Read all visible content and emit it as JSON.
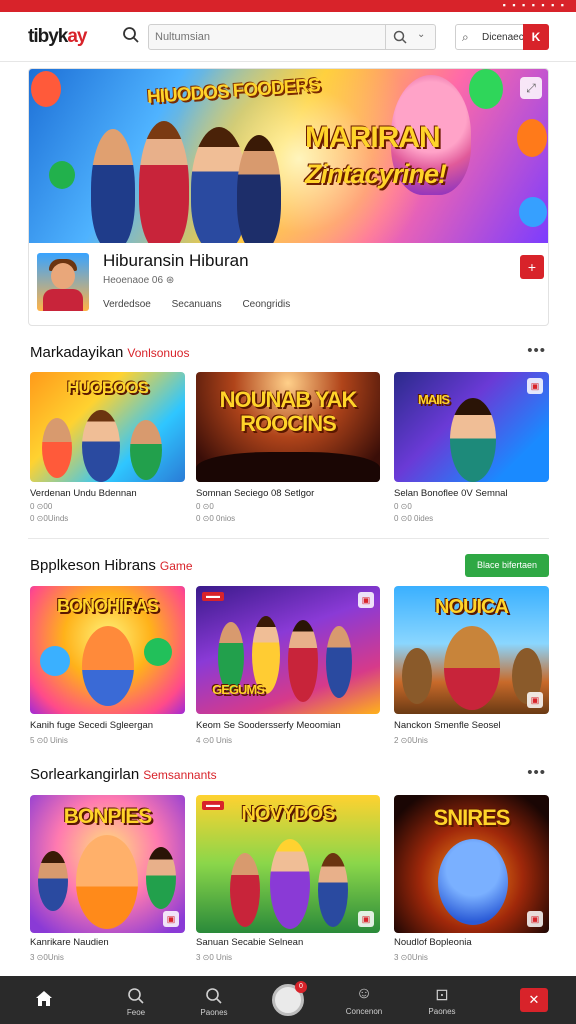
{
  "app": {
    "name_main": "tibyk",
    "name_accent": "ay"
  },
  "status_bar": {
    "icons_text": "▪ ▪ ▪ ▪ ▪ ▪ ▪"
  },
  "search": {
    "placeholder": "Nultumsian",
    "value": ""
  },
  "discover": {
    "label": "Dicenaec"
  },
  "hero": {
    "banner_line1": "HIUODOS FOODERS",
    "banner_line2": "MARIRAN",
    "banner_line3": "Zintacyrine!",
    "title": "Hiburansin Hiburan",
    "subtitle": "Heoenaoe 06 ⊛",
    "meta": [
      "Verdedsoe",
      "Secanuans",
      "Ceongridis"
    ],
    "add_icon": "+"
  },
  "sections": [
    {
      "title": "Markadayikan",
      "tag": "Vonlsonuos",
      "cards": [
        {
          "banner": "HUOBOOS",
          "title": "Verdenan Undu Bdennan",
          "meta1": "0 ⊙00",
          "meta2": "0 ⊙0Uinds"
        },
        {
          "banner": "NOUNAB YAK ROOCINS",
          "title": "Somnan Seciego 08 Setlgor",
          "meta1": "0 ⊙0",
          "meta2": "0 ⊙0 0nios"
        },
        {
          "banner": "MAIIS",
          "title": "Selan Bonoflee 0V Semnal",
          "meta1": "0 ⊙0",
          "meta2": "0 ⊙0 0ides"
        }
      ]
    },
    {
      "title": "Bpplkeson Hibrans",
      "tag": "Game",
      "button": "Blace bifertaen",
      "cards": [
        {
          "banner": "BONOHIRAS",
          "title": "Kanih fuge Secedi Sgleergan",
          "meta1": "5 ⊙0 Uinis",
          "meta2": ""
        },
        {
          "banner": "GEGUMS",
          "title": "Keom Se Soodersserfy Meoomian",
          "meta1": "4 ⊙0 Unis",
          "meta2": ""
        },
        {
          "banner": "NOUICA",
          "title": "Nanckon Smenfle Seosel",
          "meta1": "2 ⊙0Unis",
          "meta2": ""
        }
      ]
    },
    {
      "title": "Sorlearkangirlan",
      "tag": "Semsannants",
      "cards": [
        {
          "banner": "BONPIES",
          "title": "Kanrikare Naudien",
          "meta1": "3 ⊙0Unis",
          "meta2": ""
        },
        {
          "banner": "NOVYDOS",
          "title": "Sanuan Secabie Selnean",
          "meta1": "3 ⊙0 Unis",
          "meta2": ""
        },
        {
          "banner": "SNIRES",
          "title": "Noudlof Bopleonia",
          "meta1": "3 ⊙0Unis",
          "meta2": ""
        }
      ]
    }
  ],
  "bottom_nav": {
    "items": [
      {
        "icon": "home-icon",
        "label": ""
      },
      {
        "icon": "search-icon",
        "label": "Feoe"
      },
      {
        "icon": "search-icon",
        "label": "Paones"
      },
      {
        "icon": "smile-icon",
        "label": "Concenon"
      },
      {
        "icon": "box-icon",
        "label": "Paones"
      }
    ],
    "center_badge": "0"
  },
  "colors": {
    "accent": "#d8232a",
    "green": "#2fa844",
    "nav_bg": "#2a2a2a"
  }
}
